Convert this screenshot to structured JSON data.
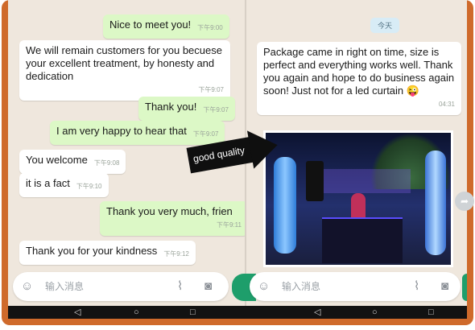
{
  "left_chat": {
    "messages": [
      {
        "text": "Nice to meet you!",
        "time": "下午9:00"
      },
      {
        "text": "We will remain customers for you becuese your excellent treatment, by honesty and dedication",
        "time": "下午9:07"
      },
      {
        "text": "Thank you!",
        "time": "下午9:07"
      },
      {
        "text": "I am very happy to hear that",
        "time": "下午9:07"
      },
      {
        "text": "You welcome",
        "time": "下午9:08"
      },
      {
        "text": "it is a fact",
        "time": "下午9:10"
      },
      {
        "text": "Thank you very much, frien",
        "time": "下午9:11"
      },
      {
        "text": "Thank you for your kindness",
        "time": "下午9:12"
      }
    ],
    "composer_placeholder": "输入消息"
  },
  "right_chat": {
    "date_label": "今天",
    "message": {
      "text": "Package came in right on time, size is perfect and everything works well. Thank you again and hope to do business again soon! Just not for a led curtain 😜",
      "time": "04:31"
    },
    "composer_placeholder": "输入消息"
  },
  "overlay": {
    "label": "good quality"
  },
  "icons": {
    "emoji": "smiley-icon",
    "attach": "paperclip-icon",
    "camera": "camera-icon",
    "back": "back-icon",
    "home": "home-icon",
    "recents": "recents-icon",
    "forward": "forward-arrow-icon"
  },
  "colors": {
    "frame": "#cf6a2b",
    "chat_bg": "#efe7dd",
    "outgoing": "#dcf8c6",
    "incoming": "#ffffff",
    "send": "#1e9e6b"
  }
}
